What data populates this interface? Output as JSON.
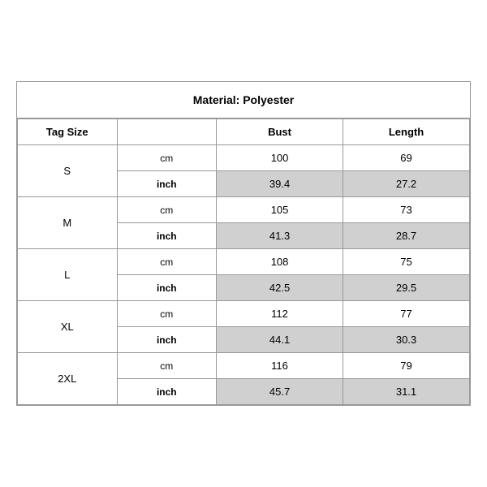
{
  "title": "Material: Polyester",
  "columns": {
    "tag_size": "Tag Size",
    "bust": "Bust",
    "length": "Length"
  },
  "rows": [
    {
      "size": "S",
      "cm": {
        "bust": "100",
        "length": "69"
      },
      "inch": {
        "bust": "39.4",
        "length": "27.2"
      }
    },
    {
      "size": "M",
      "cm": {
        "bust": "105",
        "length": "73"
      },
      "inch": {
        "bust": "41.3",
        "length": "28.7"
      }
    },
    {
      "size": "L",
      "cm": {
        "bust": "108",
        "length": "75"
      },
      "inch": {
        "bust": "42.5",
        "length": "29.5"
      }
    },
    {
      "size": "XL",
      "cm": {
        "bust": "112",
        "length": "77"
      },
      "inch": {
        "bust": "44.1",
        "length": "30.3"
      }
    },
    {
      "size": "2XL",
      "cm": {
        "bust": "116",
        "length": "79"
      },
      "inch": {
        "bust": "45.7",
        "length": "31.1"
      }
    }
  ]
}
